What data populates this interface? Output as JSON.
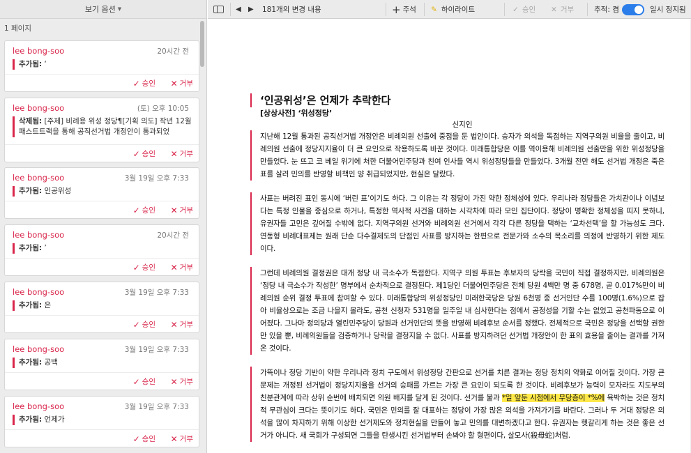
{
  "sidebar": {
    "view_options_label": "보기 옵션",
    "page_label": "1 페이지",
    "accept_label": "승인",
    "reject_label": "거부",
    "cards": [
      {
        "author": "lee bong-soo",
        "time": "20시간 전",
        "kind": "추가됨:",
        "text": "‘"
      },
      {
        "author": "lee bong-soo",
        "time": "(토) 오후 10:05",
        "kind": "삭제됨:",
        "text": "[주제] 비례용 위성 정당¶[기획 의도] 작년 12월 패스트트랙을 통해 공직선거법 개정안이 통과되었"
      },
      {
        "author": "lee bong-soo",
        "time": "3월 19일 오후 7:33",
        "kind": "추가됨:",
        "text": "인공위성"
      },
      {
        "author": "lee bong-soo",
        "time": "20시간 전",
        "kind": "추가됨:",
        "text": "’"
      },
      {
        "author": "lee bong-soo",
        "time": "3월 19일 오후 7:33",
        "kind": "추가됨:",
        "text": "은"
      },
      {
        "author": "lee bong-soo",
        "time": "3월 19일 오후 7:33",
        "kind": "추가됨:",
        "text": "공백"
      },
      {
        "author": "lee bong-soo",
        "time": "3월 19일 오후 7:33",
        "kind": "추가됨:",
        "text": "언제가"
      }
    ]
  },
  "toolbar": {
    "changes": "181개의 변경 내용",
    "comment": "주석",
    "highlight": "하이라이트",
    "accept": "승인",
    "reject": "거부",
    "tracking": "추적: 켬",
    "pause": "일시 정지됨",
    "accent": "#2b7de9"
  },
  "document": {
    "title": "‘인공위성’은 언제가 추락한다",
    "subtitle": "[상상사전] ‘위성정당’",
    "author": "신지인",
    "p1": "지난해 12월 통과된 공직선거법 개정안은 비례의원 선출에 중점을 둔 법안이다. 승자가 의석을 독점하는 지역구의원 비율을 줄이고, 비례의원 선출에 정당지지율이 더 큰 요인으로 작용하도록 바꾼 것이다. 미래통합당은 이를 역이용해 비례의원 선출만을 위한 위성정당을 만들었다. 눈 뜨고 코 베일 위기에 처한 더불어민주당과 친여 인사들 역시 위성정당들을 만들었다. 3개월 전만 해도 선거법 개정은 죽은 표를 살려 민의를 반영할 비책인 양 취급되었지만, 현실은 달랐다.",
    "p2": "사표는 버려진 표인 동시에 ‘버린 표’이기도 하다. 그 이유는 각 정당이 가진 약한 정체성에 있다. 우리나라 정당들은 가치관이나 이념보다는 특정 인물을 중심으로 하거나, 특정한 역사적 사건을 대하는 시각차에 따라 모인 집단이다. 정당이 명확한 정체성을 띠지 못하니, 유권자들 고민은 깊어질 수밖에 없다. 지역구의원 선거와 비례의원 선거에서 각각 다른 정당을 택하는 ‘교차선택’을 할 가능성도 크다. 연동형 비례대표제는 원래 단순 다수결제도의 단점인 사표를 방지하는 한편으로 전문가와 소수의 목소리를 의정에 반영하기 위한 제도이다.",
    "p3": "그런데 비례의원 결정권은 대개 정당 내 극소수가 독점한다. 지역구 의원 투표는 후보자의 당락을 국민이 직접 결정하지만, 비례의원은 ‘정당 내 극소수가 작성한’ 명부에서 순차적으로 결정된다. 제1당인 더불어민주당은 전체 당원 4백만 명 중 678명, 곧 0.017%만이 비례의원 순위 결정 투표에 참여할 수 있다. 미래통합당의 위성정당인 미래한국당은 당원 6천명 중 선거인단 수를 100명(1.6%)으로 잡아 비율상으로는 조금 나을지 몰라도, 공천 신청자 531명을 일주일 내 심사한다는 점에서 공정성을 기할 수는 없었고 공천파동으로 이어졌다. 그나마 정의당과 열린민주당이 당원과 선거인단의 뜻을 반영해 비례후보 순서를 정했다. 전체적으로 국민은 정당을 선택할 권한만 있을 뿐, 비례의원들을 검증하거나 당락을 결정지을 수 없다. 사표를 방지하려던 선거법 개정안이 한 표의 효용을 줄이는 결과를 가져온 것이다.",
    "p4a": "가뜩이나 정당 기반이 약한 우리나라 정치 구도에서 위성정당 간판으로 선거를 치른 결과는 정당 정치의 약화로 이어질 것이다. 가장 큰 문제는 개정된 선거법이 정당지지율을 선거의 승패를 가르는 가장 큰 요인이 되도록 한 것이다. 비례후보가 능력이 모자라도 지도부의 친분관계에 따라 상위 순번에 배치되면 의원 배지를 달게 된 것이다. 선거를 불과 ",
    "p4_highlight": "*일 앞둔 시점에서 무당층이 *%에",
    "p4b": " 육박하는 것은 정치적 무관심이 크다는 뜻이기도 하다. 국민은 민의를 잘 대표하는 정당이 가장 많은 의석을 가져가기를 바란다. 그러나 두 거대 정당은 의석을 많이 차지하기 위해 이상한 선거제도와 정치현실을 만들어 놓고 민의를 대변하겠다고 한다. 유권자는 헷갈리게 하는 것은 좋은 선거가 아니다. 새 국회가 구성되면 그들을 탄생시킨 선거법부터 손봐야 할 형편이다, 살모사(殺母蛇)처럼."
  }
}
